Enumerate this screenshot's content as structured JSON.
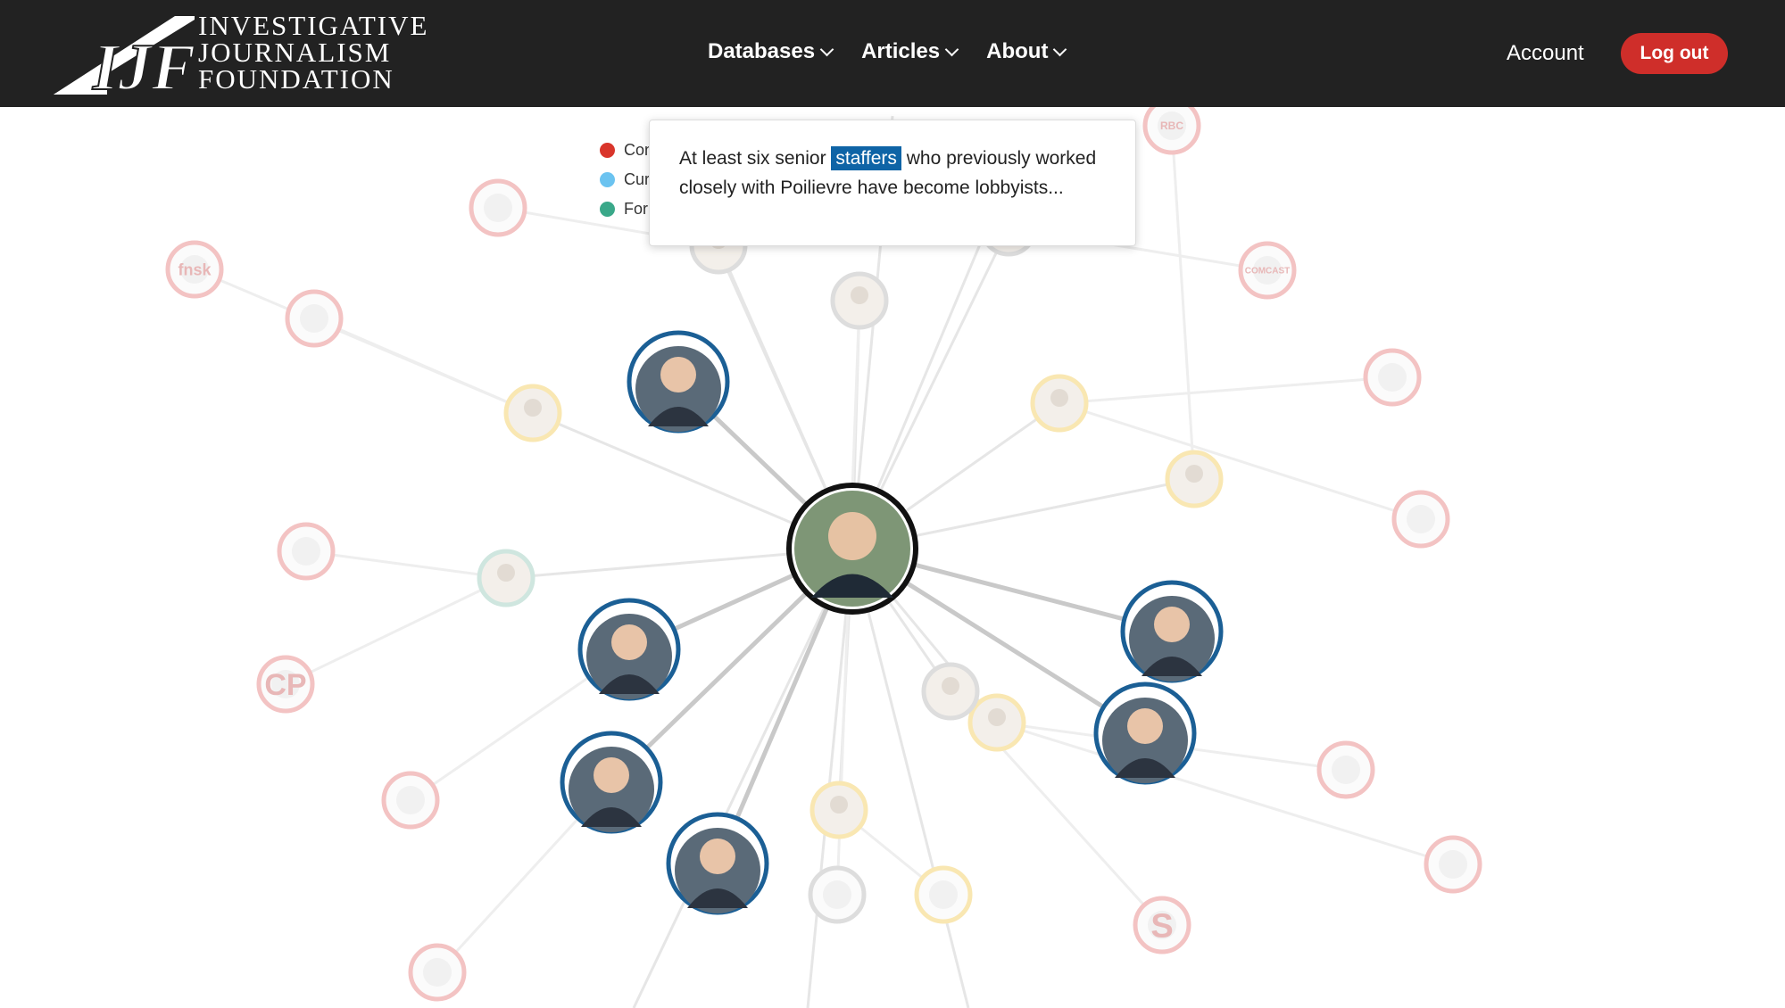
{
  "site": {
    "logo_lines": [
      "INVESTIGATIVE",
      "JOURNALISM",
      "FOUNDATION"
    ],
    "logo_mark_letters": "IJF"
  },
  "nav": [
    {
      "label": "Databases"
    },
    {
      "label": "Articles"
    },
    {
      "label": "About"
    }
  ],
  "account_label": "Account",
  "logout_label": "Log out",
  "legend": [
    {
      "label": "Con",
      "color": "#d9352b"
    },
    {
      "label": "Cur",
      "color": "#6bc3f0"
    },
    {
      "label": "For",
      "color": "#3aa889"
    }
  ],
  "tooltip": {
    "before": "At least six senior ",
    "highlight": "staffers",
    "after": " who previously worked closely with Poilievre have become lobbyists..."
  },
  "colors": {
    "header_bg": "#222222",
    "accent_red": "#cf2e2a",
    "highlight_blue": "#0f64a6",
    "node_ring_blue": "#1b5f95",
    "faded_red": "#f3c3c3",
    "faded_yellow": "#f9e7b2",
    "faded_gray": "#dddddd",
    "faded_green": "#cfe6df"
  },
  "graph": {
    "central_node": "politician-photo",
    "featured_nodes": [
      "staffer-photo",
      "staffer-photo",
      "staffer-photo",
      "staffer-photo",
      "staffer-photo",
      "staffer-photo",
      "staffer-photo"
    ],
    "org_logo_texts": [
      "CP",
      "S",
      "fnsk",
      "RBC",
      "COMCAST"
    ]
  }
}
